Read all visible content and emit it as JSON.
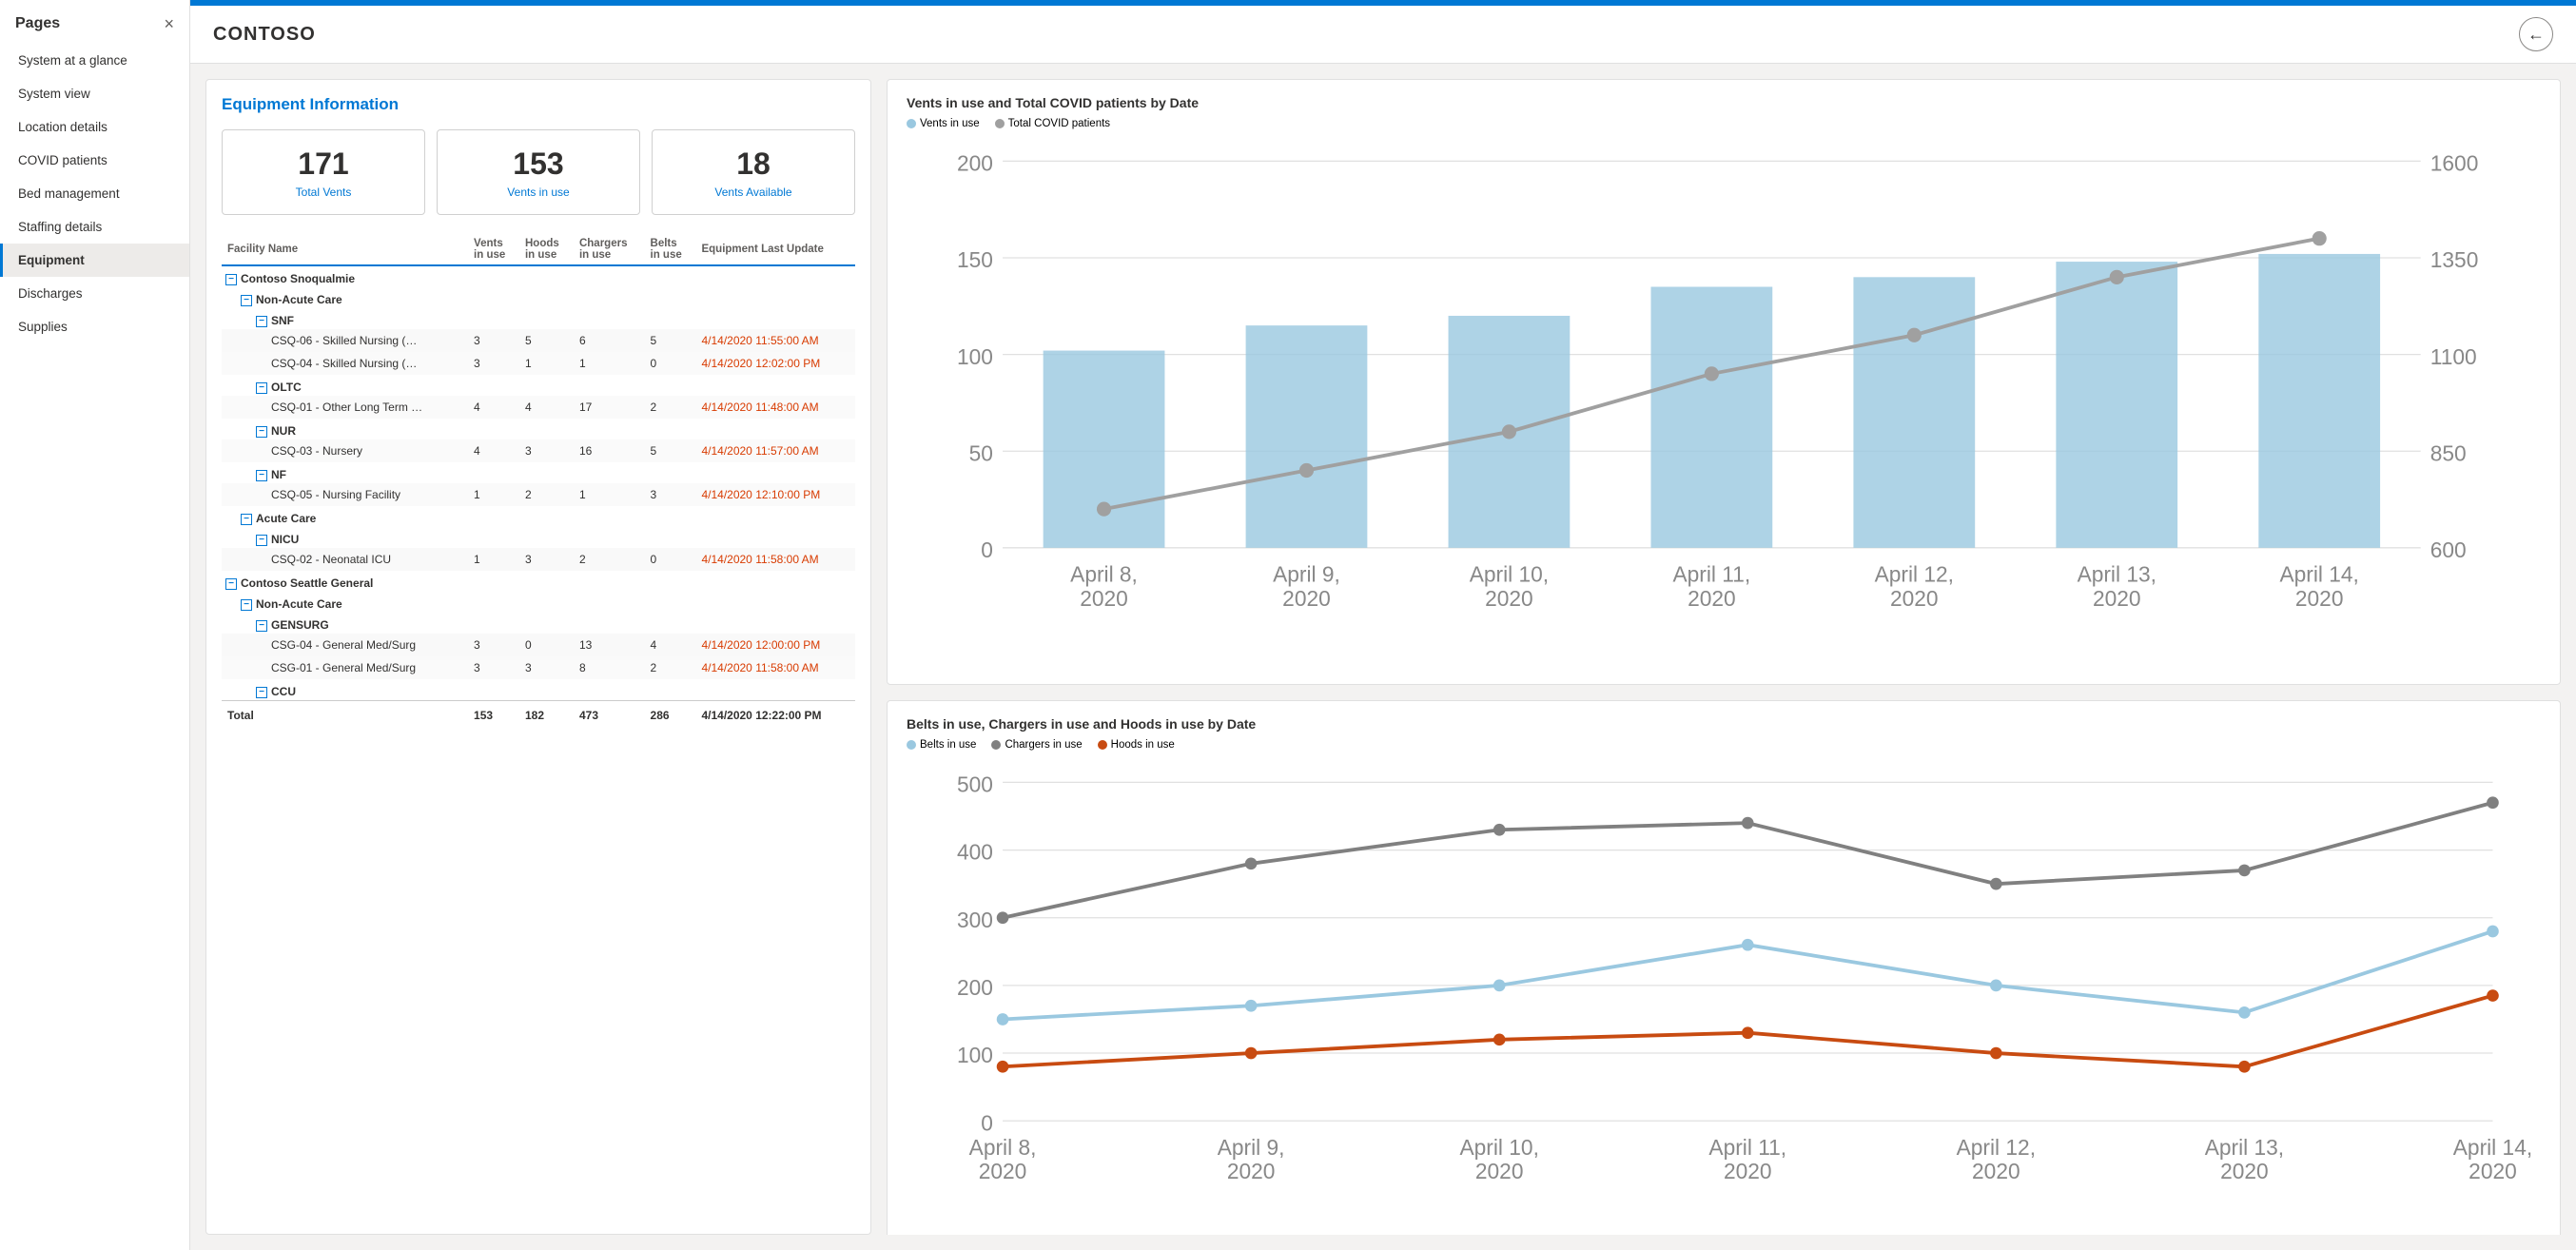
{
  "sidebar": {
    "header": "Pages",
    "close_label": "×",
    "items": [
      {
        "id": "system-glance",
        "label": "System at a glance",
        "active": false
      },
      {
        "id": "system-view",
        "label": "System view",
        "active": false
      },
      {
        "id": "location-details",
        "label": "Location details",
        "active": false
      },
      {
        "id": "covid-patients",
        "label": "COVID patients",
        "active": false
      },
      {
        "id": "bed-management",
        "label": "Bed management",
        "active": false
      },
      {
        "id": "staffing-details",
        "label": "Staffing details",
        "active": false
      },
      {
        "id": "equipment",
        "label": "Equipment",
        "active": true
      },
      {
        "id": "discharges",
        "label": "Discharges",
        "active": false
      },
      {
        "id": "supplies",
        "label": "Supplies",
        "active": false
      }
    ]
  },
  "header": {
    "title": "CONTOSO",
    "back_label": "←"
  },
  "equipment": {
    "title": "Equipment Information",
    "stats": [
      {
        "number": "171",
        "label": "Total Vents"
      },
      {
        "number": "153",
        "label": "Vents in use"
      },
      {
        "number": "18",
        "label": "Vents Available"
      }
    ],
    "table": {
      "columns": [
        "Facility Name",
        "Vents in use",
        "Hoods in use",
        "Chargers in use",
        "Belts in use",
        "Equipment Last Update"
      ],
      "groups": [
        {
          "name": "Contoso Snoqualmie",
          "level": 0,
          "children": [
            {
              "name": "Non-Acute Care",
              "level": 1,
              "children": [
                {
                  "name": "SNF",
                  "level": 2,
                  "rows": [
                    {
                      "facility": "CSQ-06 - Skilled Nursing (…",
                      "vents": "3",
                      "hoods": "5",
                      "chargers": "6",
                      "belts": "5",
                      "update": "4/14/2020 11:55:00 AM"
                    },
                    {
                      "facility": "CSQ-04 - Skilled Nursing (…",
                      "vents": "3",
                      "hoods": "1",
                      "chargers": "1",
                      "belts": "0",
                      "update": "4/14/2020 12:02:00 PM"
                    }
                  ]
                },
                {
                  "name": "OLTC",
                  "level": 2,
                  "rows": [
                    {
                      "facility": "CSQ-01 - Other Long Term …",
                      "vents": "4",
                      "hoods": "4",
                      "chargers": "17",
                      "belts": "2",
                      "update": "4/14/2020 11:48:00 AM"
                    }
                  ]
                },
                {
                  "name": "NUR",
                  "level": 2,
                  "rows": [
                    {
                      "facility": "CSQ-03 - Nursery",
                      "vents": "4",
                      "hoods": "3",
                      "chargers": "16",
                      "belts": "5",
                      "update": "4/14/2020 11:57:00 AM"
                    }
                  ]
                },
                {
                  "name": "NF",
                  "level": 2,
                  "rows": [
                    {
                      "facility": "CSQ-05 - Nursing Facility",
                      "vents": "1",
                      "hoods": "2",
                      "chargers": "1",
                      "belts": "3",
                      "update": "4/14/2020 12:10:00 PM"
                    }
                  ]
                }
              ]
            },
            {
              "name": "Acute Care",
              "level": 1,
              "children": [
                {
                  "name": "NICU",
                  "level": 2,
                  "rows": [
                    {
                      "facility": "CSQ-02 - Neonatal ICU",
                      "vents": "1",
                      "hoods": "3",
                      "chargers": "2",
                      "belts": "0",
                      "update": "4/14/2020 11:58:00 AM"
                    }
                  ]
                }
              ]
            }
          ]
        },
        {
          "name": "Contoso Seattle General",
          "level": 0,
          "children": [
            {
              "name": "Non-Acute Care",
              "level": 1,
              "children": [
                {
                  "name": "GENSURG",
                  "level": 2,
                  "rows": [
                    {
                      "facility": "CSG-04 - General Med/Surg",
                      "vents": "3",
                      "hoods": "0",
                      "chargers": "13",
                      "belts": "4",
                      "update": "4/14/2020 12:00:00 PM"
                    },
                    {
                      "facility": "CSG-01 - General Med/Surg",
                      "vents": "3",
                      "hoods": "3",
                      "chargers": "8",
                      "belts": "2",
                      "update": "4/14/2020 11:58:00 AM"
                    }
                  ]
                },
                {
                  "name": "CCU",
                  "level": 2,
                  "rows": []
                }
              ]
            }
          ]
        }
      ],
      "total": {
        "label": "Total",
        "vents": "153",
        "hoods": "182",
        "chargers": "473",
        "belts": "286",
        "update": "4/14/2020 12:22:00 PM"
      }
    }
  },
  "charts": {
    "chart1": {
      "title": "Vents in use and Total COVID patients by Date",
      "legend": [
        {
          "label": "Vents in use",
          "color": "#9ac8e0"
        },
        {
          "label": "Total COVID patients",
          "color": "#a0a0a0"
        }
      ],
      "dates": [
        "April 8,\n2020",
        "April 9,\n2020",
        "April 10,\n2020",
        "April 11,\n2020",
        "April 12,\n2020",
        "April 13,\n2020",
        "April 14,\n2020"
      ],
      "bars": [
        102,
        115,
        120,
        135,
        140,
        148,
        152
      ],
      "line": [
        700,
        800,
        900,
        1050,
        1150,
        1300,
        1400
      ],
      "y_left_max": 200,
      "y_right_max": 1600,
      "y_right_min": 600
    },
    "chart2": {
      "title": "Belts in use, Chargers in use and Hoods in use by Date",
      "legend": [
        {
          "label": "Belts in use",
          "color": "#9ac8e0"
        },
        {
          "label": "Chargers in use",
          "color": "#808080"
        },
        {
          "label": "Hoods in use",
          "color": "#c84b11"
        }
      ],
      "dates": [
        "April 8,\n2020",
        "April 9,\n2020",
        "April 10,\n2020",
        "April 11,\n2020",
        "April 12,\n2020",
        "April 13,\n2020",
        "April 14,\n2020"
      ],
      "lines": {
        "belts": [
          150,
          170,
          200,
          260,
          200,
          160,
          280
        ],
        "chargers": [
          300,
          380,
          430,
          440,
          350,
          370,
          470
        ],
        "hoods": [
          80,
          100,
          120,
          130,
          100,
          80,
          185
        ]
      },
      "y_max": 500
    }
  }
}
